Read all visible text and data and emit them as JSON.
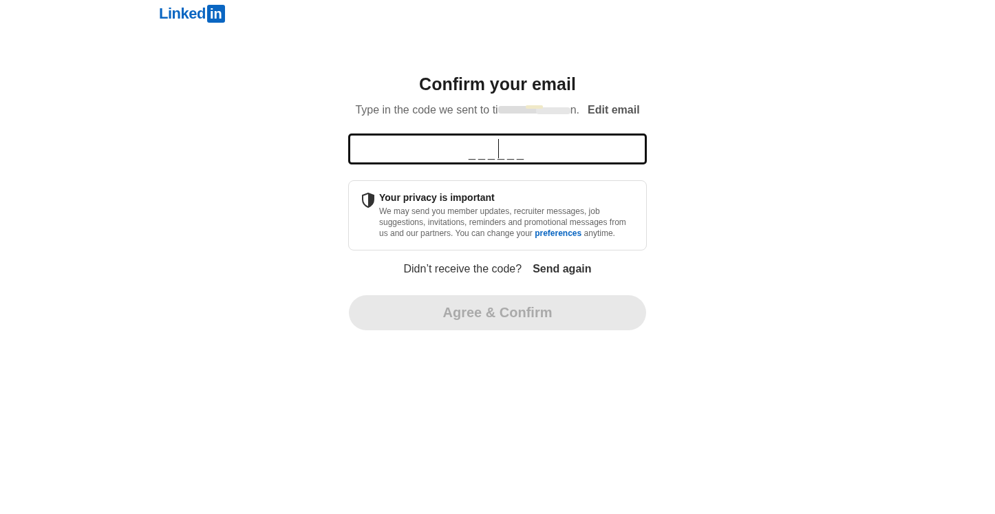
{
  "logo": {
    "text": "Linked",
    "badge": "in"
  },
  "title": "Confirm your email",
  "subtitle": {
    "prefix": "Type in the code we sent to ti",
    "suffix": "n.",
    "link": "Edit email"
  },
  "code_field": {
    "placeholder": "______"
  },
  "privacy": {
    "title": "Your privacy is important",
    "body": "We may send you member updates, recruiter messages, job suggestions, invitations, reminders and promotional messages from us and our partners. You can change your",
    "link": "preferences",
    "tail": "anytime."
  },
  "resend": {
    "text": "Didn’t receive the code?",
    "link": "Send again"
  },
  "submit": {
    "label": "Agree & Confirm",
    "disabled": true
  }
}
